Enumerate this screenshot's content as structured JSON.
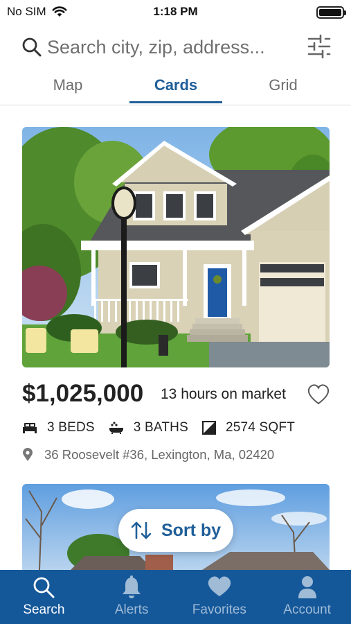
{
  "status_bar": {
    "carrier": "No SIM",
    "time": "1:18 PM"
  },
  "search": {
    "placeholder": "Search city, zip, address..."
  },
  "tabs": [
    {
      "label": "Map",
      "selected": false
    },
    {
      "label": "Cards",
      "selected": true
    },
    {
      "label": "Grid",
      "selected": false
    }
  ],
  "listing": {
    "price": "$1,025,000",
    "time_on_market": "13 hours on market",
    "beds": "3 BEDS",
    "baths": "3 BATHS",
    "sqft": "2574 SQFT",
    "address": "36 Roosevelt #36, Lexington, Ma, 02420",
    "favorited": false
  },
  "sort_button": {
    "label": "Sort by"
  },
  "bottom_nav": [
    {
      "label": "Search",
      "icon": "search-icon",
      "active": true
    },
    {
      "label": "Alerts",
      "icon": "bell-icon",
      "active": false
    },
    {
      "label": "Favorites",
      "icon": "heart-icon",
      "active": false
    },
    {
      "label": "Account",
      "icon": "person-icon",
      "active": false
    }
  ],
  "colors": {
    "accent": "#1f5f99",
    "nav_background": "#15589a",
    "nav_inactive": "#9fbbd6"
  }
}
